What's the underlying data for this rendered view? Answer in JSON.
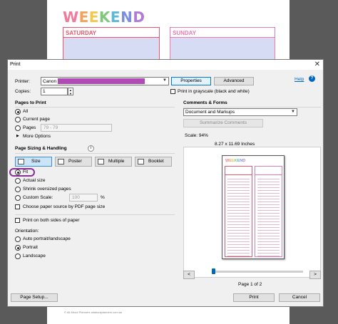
{
  "background_page": {
    "title_letters": [
      "W",
      "E",
      "E",
      "K",
      "E",
      "N",
      "D"
    ],
    "title_colors": [
      "#f07b9c",
      "#f4a25a",
      "#f2c94c",
      "#7fc77a",
      "#5bb8d6",
      "#7b8fe0",
      "#b07ad6"
    ],
    "saturday": "SATURDAY",
    "sunday": "SUNDAY",
    "footer": "© All About Planners   allaboutplanners.com.au"
  },
  "dialog": {
    "title": "Print",
    "close_glyph": "✕",
    "help_link": "Help",
    "printer_label": "Printer:",
    "printer_value": "Canon",
    "printer_highlight_color": "#b04bb5",
    "properties_button": "Properties",
    "advanced_button": "Advanced",
    "copies_label": "Copies:",
    "copies_value": "1",
    "grayscale_label": "Print in grayscale (black and white)",
    "pages_to_print": {
      "title": "Pages to Print",
      "all": "All",
      "current_page": "Current page",
      "pages": "Pages",
      "pages_value": "79 - 79",
      "more_options": "More Options"
    },
    "sizing": {
      "title": "Page Sizing & Handling",
      "size_button": "Size",
      "poster_button": "Poster",
      "multiple_button": "Multiple",
      "booklet_button": "Booklet",
      "fit": "Fit",
      "actual_size": "Actual size",
      "shrink": "Shrink oversized pages",
      "custom_scale": "Custom Scale:",
      "custom_scale_value": "100",
      "percent": "%",
      "paper_source": "Choose paper source by PDF page size"
    },
    "both_sides": "Print on both sides of paper",
    "orientation": {
      "title": "Orientation:",
      "auto": "Auto portrait/landscape",
      "portrait": "Portrait",
      "landscape": "Landscape"
    },
    "comments_forms": {
      "title": "Comments & Forms",
      "value": "Document and Markups",
      "summarize_button": "Summarize Comments"
    },
    "scale_text": "Scale: 94%",
    "paper_size_text": "8.27 x 11.69 Inches",
    "preview_mini_title": "WEEKEND",
    "page_indicator": "Page 1 of 2",
    "prev_glyph": "<",
    "next_glyph": ">",
    "page_setup_button": "Page Setup...",
    "print_button": "Print",
    "cancel_button": "Cancel"
  }
}
